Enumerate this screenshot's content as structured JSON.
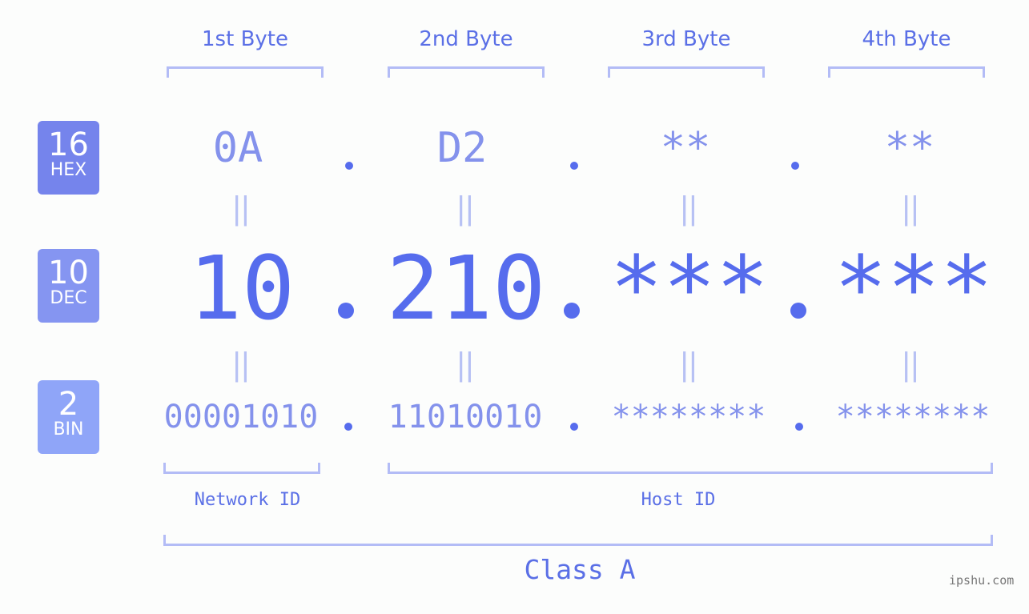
{
  "byte_headers": [
    "1st Byte",
    "2nd Byte",
    "3rd Byte",
    "4th Byte"
  ],
  "badges": {
    "hex": {
      "number": "16",
      "label": "HEX"
    },
    "dec": {
      "number": "10",
      "label": "DEC"
    },
    "bin": {
      "number": "2",
      "label": "BIN"
    }
  },
  "hex_values": [
    "0A",
    "D2",
    "**",
    "**"
  ],
  "dec_values": [
    "10",
    "210",
    "***",
    "***"
  ],
  "bin_values": [
    "00001010",
    "11010010",
    "********",
    "********"
  ],
  "equals_symbol": "||",
  "network_id_label": "Network ID",
  "host_id_label": "Host ID",
  "class_label": "Class A",
  "watermark": "ipshu.com",
  "colors": {
    "primary": "#566ced",
    "hex_badge": "#7584ec",
    "dec_badge": "#8595f1",
    "bin_badge": "#8fa5f8",
    "bracket": "#b3bcf6",
    "light_value": "#8492ec"
  }
}
